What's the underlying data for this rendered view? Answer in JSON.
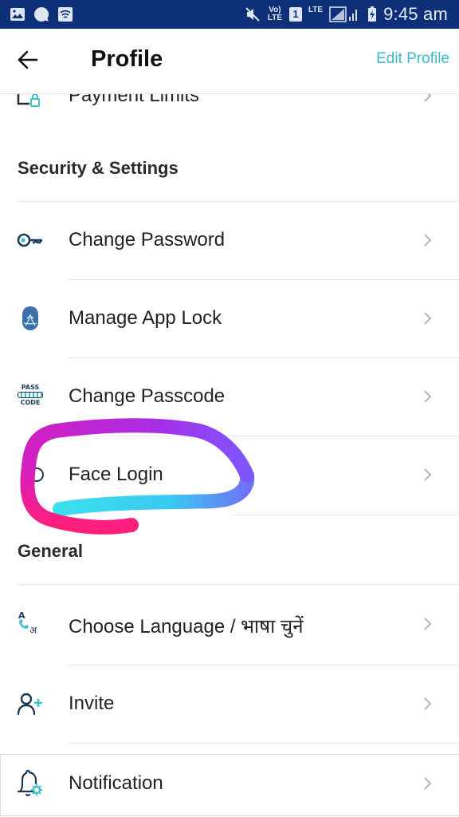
{
  "status_bar": {
    "time": "9:45 am",
    "left_icons": [
      "gallery-icon",
      "chat-bubble-icon",
      "wifi-icon"
    ],
    "right_icons": [
      "mute-icon",
      "volte-icon",
      "sim-1-icon",
      "lte-icon",
      "signal-icon",
      "battery-charging-icon"
    ],
    "volte_label": "Vo) LTE",
    "sim_label": "1",
    "lte_label": "LTE"
  },
  "header": {
    "title": "Profile",
    "edit_label": "Edit Profile",
    "accent_color": "#3fb7cc"
  },
  "partial_item": {
    "label": "Payment Limits",
    "icon": "payment-limits-icon"
  },
  "sections": [
    {
      "title": "Security & Settings",
      "items": [
        {
          "label": "Change Password",
          "icon": "key-icon"
        },
        {
          "label": "Manage App Lock",
          "icon": "fingerprint-icon"
        },
        {
          "label": "Change Passcode",
          "icon": "passcode-icon",
          "icon_text_top": "PASS",
          "icon_text_bottom": "CODE"
        },
        {
          "label": "Face Login",
          "icon": "face-icon",
          "highlighted": true
        }
      ]
    },
    {
      "title": "General",
      "items": [
        {
          "label": "Choose Language / भाषा चुनें",
          "icon": "language-icon"
        },
        {
          "label": "Invite",
          "icon": "add-user-icon"
        },
        {
          "label": "Notification",
          "icon": "notification-settings-icon"
        }
      ]
    }
  ],
  "annotation": {
    "type": "hand-drawn loop",
    "colors": [
      "#ff1f7a",
      "#c21fd6",
      "#8a4cff",
      "#3ad8ee"
    ]
  }
}
